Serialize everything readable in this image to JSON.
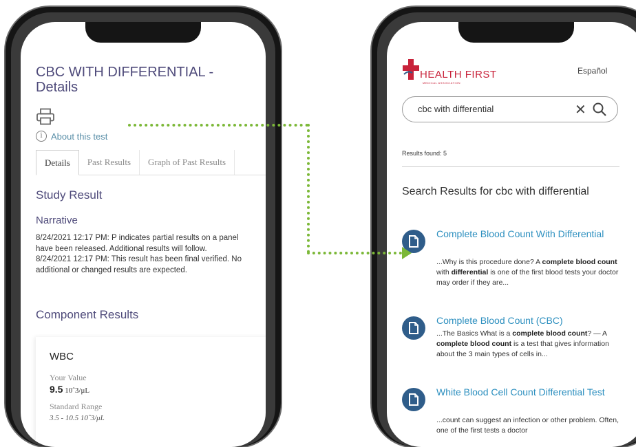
{
  "left_screen": {
    "title": "CBC WITH DIFFERENTIAL - Details",
    "about_link": "About this test",
    "tabs": [
      "Details",
      "Past Results",
      "Graph of Past Results"
    ],
    "study_result_heading": "Study Result",
    "narrative_heading": "Narrative",
    "narrative": [
      "8/24/2021 12:17 PM: P indicates partial results on a panel have been released. Additional results will follow.",
      "8/24/2021 12:17 PM: This result has been final verified. No additional or changed results are expected."
    ],
    "component_heading": "Component Results",
    "component": {
      "name": "WBC",
      "your_value_label": "Your Value",
      "value": "9.5",
      "unit": "10ˆ3/μL",
      "range_label": "Standard Range",
      "range": "3.5 - 10.5 10ˆ3/μL"
    }
  },
  "right_screen": {
    "brand": "HEALTH FIRST",
    "brand_sub": "MEDICAL ASSOCIATION",
    "language_link": "Español",
    "search": {
      "value": "cbc with differential"
    },
    "results_found": "Results found: 5",
    "results_heading": "Search Results for cbc with differential",
    "results": [
      {
        "title": "Complete Blood Count With Differential",
        "snippet": [
          {
            "t": "...Why is this procedure done? A ",
            "b": false
          },
          {
            "t": "complete blood count",
            "b": true
          },
          {
            "t": " with ",
            "b": false
          },
          {
            "t": "differential",
            "b": true
          },
          {
            "t": " is one of the first blood tests your doctor may order if they are...",
            "b": false
          }
        ]
      },
      {
        "title": "Complete Blood Count (CBC)",
        "snippet": [
          {
            "t": "...The Basics What is a ",
            "b": false
          },
          {
            "t": "complete blood count",
            "b": true
          },
          {
            "t": "? — A ",
            "b": false
          },
          {
            "t": "complete blood count",
            "b": true
          },
          {
            "t": " is a test that gives information about the 3 main types of cells in...",
            "b": false
          }
        ]
      },
      {
        "title": "White Blood Cell Count Differential Test",
        "snippet": [
          {
            "t": "...count can suggest an infection or other problem. Often, one of the first tests a doctor",
            "b": false
          }
        ]
      }
    ]
  },
  "colors": {
    "heading_purple": "#4e4a7a",
    "link_blue": "#2c8fbf",
    "brand_red": "#c8223a",
    "connector_green": "#7cb838",
    "result_icon_blue": "#2f5d8a"
  }
}
